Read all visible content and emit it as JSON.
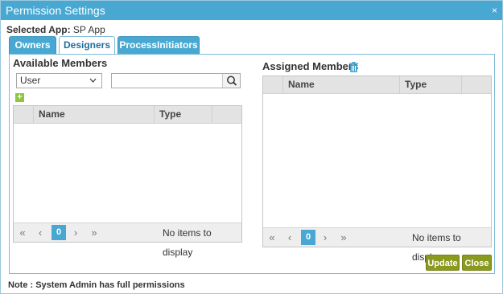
{
  "window": {
    "title": "Permission Settings",
    "close_glyph": "×"
  },
  "selected_app": {
    "label": "Selected App:",
    "value": "SP App"
  },
  "tabs": [
    {
      "label": "Owners",
      "active": false
    },
    {
      "label": "Designers",
      "active": true
    },
    {
      "label": "ProcessInitiators",
      "active": false
    }
  ],
  "available": {
    "title": "Available Members",
    "type_select": "User",
    "search_placeholder": "",
    "columns": [
      "Name",
      "Type"
    ],
    "pager": {
      "first": "«",
      "prev": "‹",
      "page": "0",
      "next": "›",
      "last": "»",
      "empty_text": "No items to display"
    }
  },
  "assigned": {
    "title": "Assigned Members",
    "columns": [
      "Name",
      "Type"
    ],
    "pager": {
      "first": "«",
      "prev": "‹",
      "page": "0",
      "next": "›",
      "last": "»",
      "empty_text": "No items to display"
    }
  },
  "buttons": {
    "update": "Update",
    "close": "Close"
  },
  "note": "Note : System Admin has full permissions",
  "colors": {
    "title_bar": "#48a8d2",
    "tab": "#48a8d2",
    "button": "#8a9a1f",
    "add_icon": "#8dc53e"
  }
}
